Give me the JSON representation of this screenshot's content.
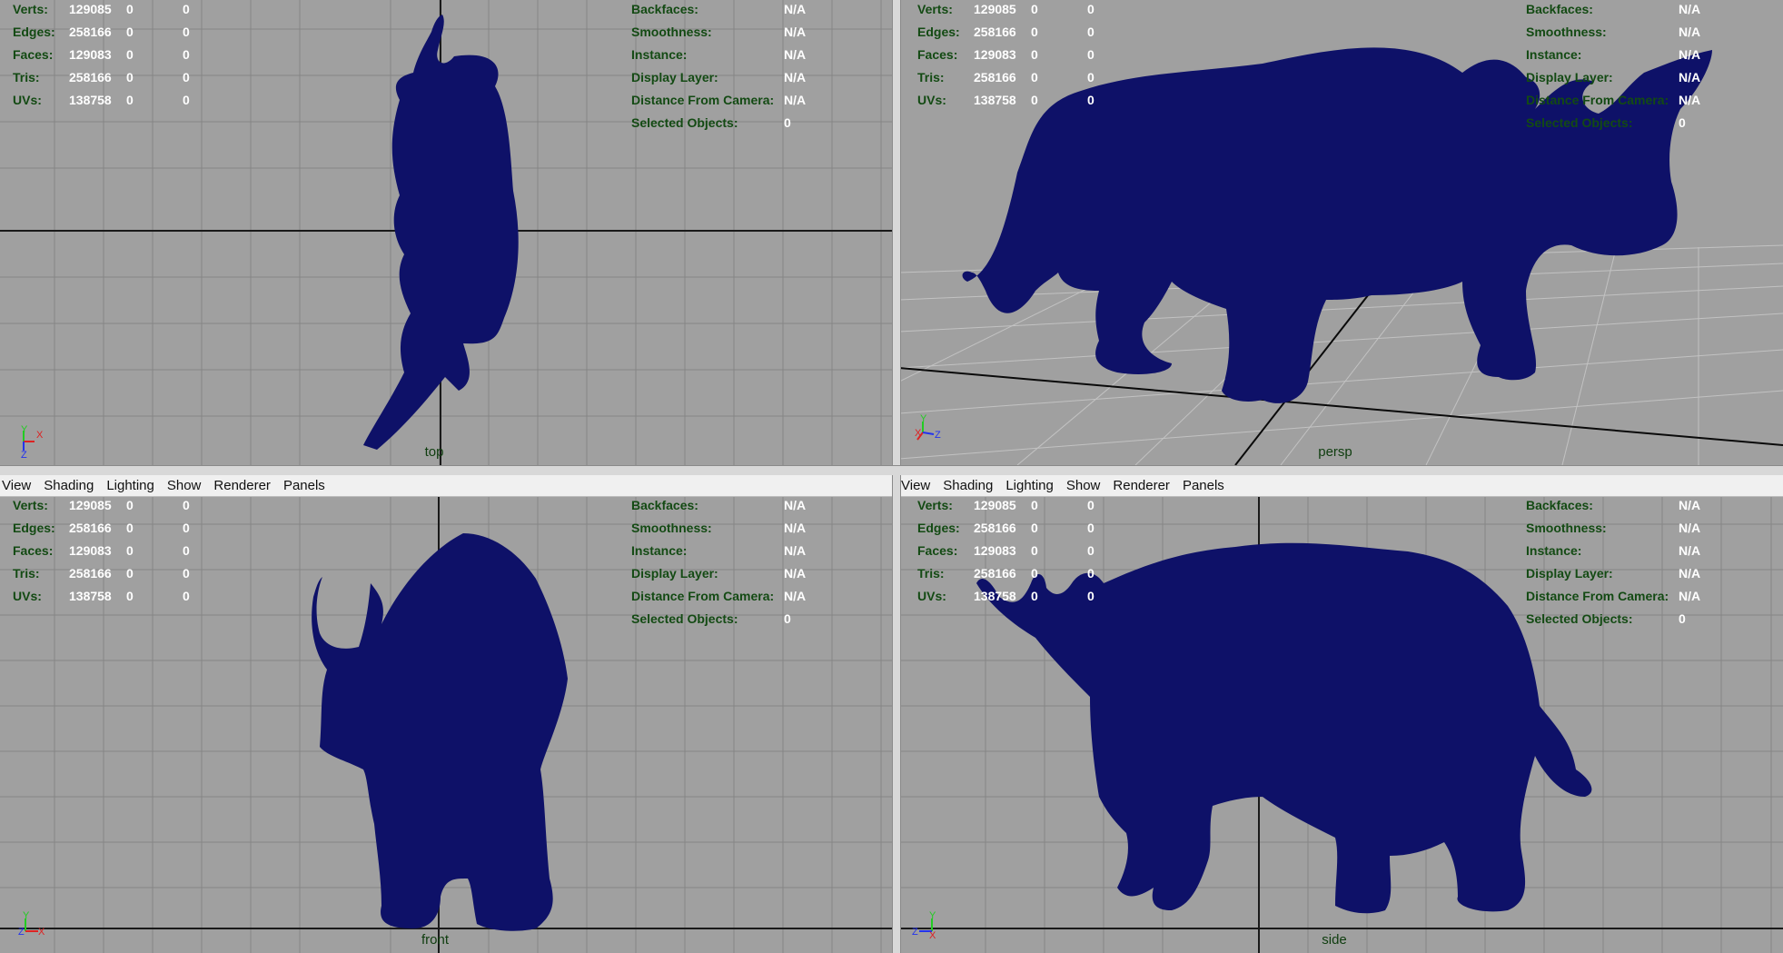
{
  "menu": [
    "View",
    "Shading",
    "Lighting",
    "Show",
    "Renderer",
    "Panels"
  ],
  "hud_left": [
    {
      "label": "Verts:",
      "v1": "129085",
      "v2": "0",
      "v3": "0"
    },
    {
      "label": "Edges:",
      "v1": "258166",
      "v2": "0",
      "v3": "0"
    },
    {
      "label": "Faces:",
      "v1": "129083",
      "v2": "0",
      "v3": "0"
    },
    {
      "label": "Tris:",
      "v1": "258166",
      "v2": "0",
      "v3": "0"
    },
    {
      "label": "UVs:",
      "v1": "138758",
      "v2": "0",
      "v3": "0"
    }
  ],
  "hud_right": [
    {
      "label": "Backfaces:",
      "value": "N/A"
    },
    {
      "label": "Smoothness:",
      "value": "N/A"
    },
    {
      "label": "Instance:",
      "value": "N/A"
    },
    {
      "label": "Display Layer:",
      "value": "N/A"
    },
    {
      "label": "Distance From Camera:",
      "value": "N/A"
    },
    {
      "label": "Selected Objects:",
      "value": "0"
    }
  ],
  "viewports": {
    "top": {
      "camera": "top",
      "axes": [
        "Y",
        "X",
        "Z"
      ]
    },
    "persp": {
      "camera": "persp",
      "axes": [
        "Y",
        "X",
        "Z"
      ]
    },
    "front": {
      "camera": "front",
      "axes": [
        "Y",
        "Z",
        "X"
      ]
    },
    "side": {
      "camera": "side",
      "axes": [
        "Y",
        "Z",
        "X"
      ]
    }
  },
  "colors": {
    "viewport_bg": "#a0a0a0",
    "grid": "#868686",
    "model": "#0e1168",
    "hud_label": "#134a13",
    "hud_value": "#ffffff"
  }
}
